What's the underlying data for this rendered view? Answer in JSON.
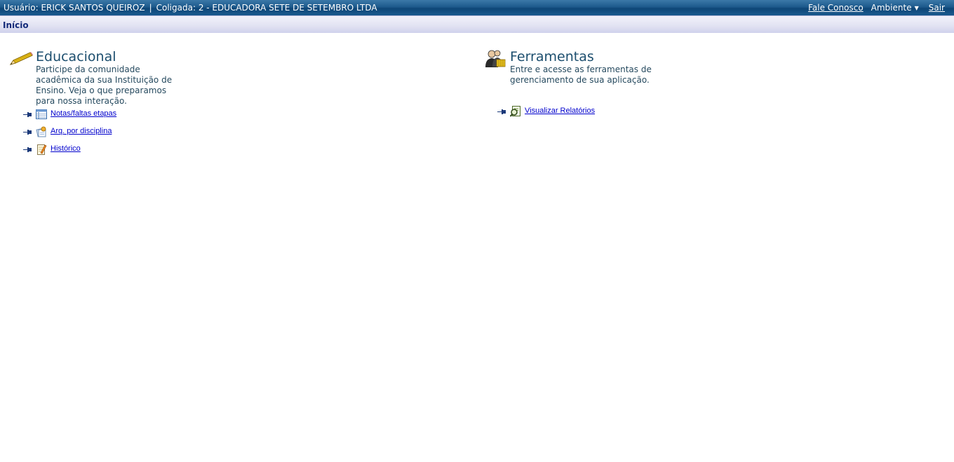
{
  "topbar": {
    "user_label": "Usuário: ERICK SANTOS QUEIROZ",
    "separator": "|",
    "coligada_label": "Coligada: 2 - EDUCADORA SETE DE SETEMBRO LTDA",
    "contact_link": "Fale Conosco",
    "ambiente_menu": "Ambiente",
    "exit_link": "Sair"
  },
  "breadcrumb": {
    "current": "Início"
  },
  "educacional": {
    "title": "Educacional",
    "description": "Participe da comunidade acadêmica da sua Instituição de Ensino. Veja o que preparamos para nossa interação.",
    "links": [
      {
        "label": "Notas/faltas etapas",
        "icon": "grid-table-icon"
      },
      {
        "label": "Arq. por disciplina",
        "icon": "files-icon"
      },
      {
        "label": "Histórico",
        "icon": "notepad-pencil-icon"
      }
    ]
  },
  "ferramentas": {
    "title": "Ferramentas",
    "description": "Entre e acesse as ferramentas de gerenciamento de sua aplicação.",
    "links": [
      {
        "label": "Visualizar Relatórios",
        "icon": "report-magnifier-icon"
      }
    ]
  },
  "colors": {
    "topbar": "#1d5a8c",
    "breadcrumb_text": "#142b7a",
    "section_title": "#1c4e6e",
    "link": "#0000cc"
  }
}
